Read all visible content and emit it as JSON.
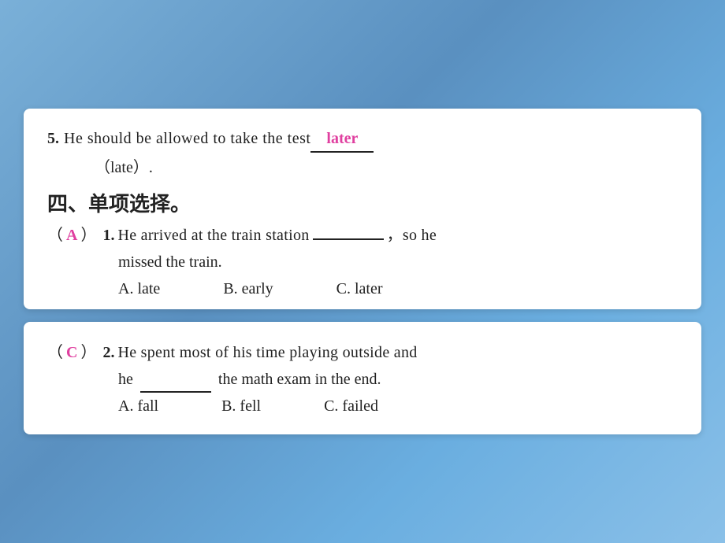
{
  "card1": {
    "q5_number": "5.",
    "q5_sentence": "He should be allowed to take the test",
    "q5_answer": "later",
    "q5_hint": "（late）.",
    "section_title": "四、单项选择。",
    "mc1": {
      "paren_open": "（",
      "answer_letter": "A",
      "paren_close": "）",
      "number": "1.",
      "sentence_part1": "He arrived at the train station",
      "sentence_part2": "，so he",
      "second_line": "missed the train.",
      "option_a": "A. late",
      "option_b": "B. early",
      "option_c": "C. later"
    }
  },
  "card2": {
    "mc2": {
      "paren_open": "（",
      "answer_letter": "C",
      "paren_close": "）",
      "number": "2.",
      "sentence_part1": "He spent most of his time playing outside and",
      "second_line_part1": "he",
      "second_line_part2": "the math exam in the end.",
      "option_a": "A. fall",
      "option_b": "B. fell",
      "option_c": "C. failed"
    }
  }
}
